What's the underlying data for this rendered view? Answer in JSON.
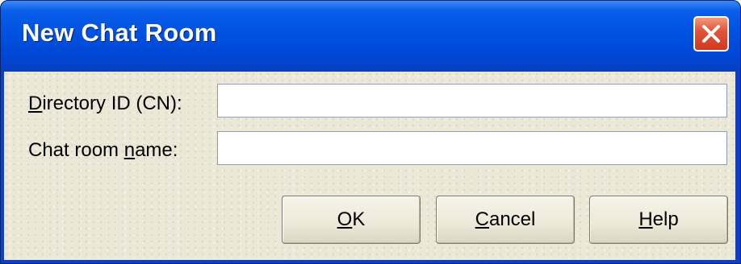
{
  "dialog": {
    "title": "New Chat Room",
    "close_icon": "close-icon"
  },
  "form": {
    "directory_id": {
      "label_prefix": "",
      "label_mnemonic": "D",
      "label_rest": "irectory ID (CN):",
      "value": ""
    },
    "chat_room_name": {
      "label_prefix": "Chat room ",
      "label_mnemonic": "n",
      "label_rest": "ame:",
      "value": ""
    }
  },
  "buttons": {
    "ok": {
      "prefix": "",
      "mnemonic": "O",
      "rest": "K"
    },
    "cancel": {
      "prefix": "",
      "mnemonic": "C",
      "rest": "ancel"
    },
    "help": {
      "prefix": "",
      "mnemonic": "H",
      "rest": "elp"
    }
  },
  "colors": {
    "titlebar": "#0052e0",
    "close_button": "#e2553b",
    "client_background": "#ece9d8"
  }
}
